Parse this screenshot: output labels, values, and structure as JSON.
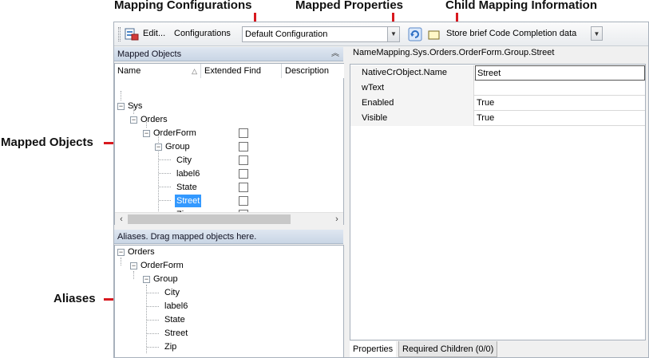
{
  "callouts": {
    "mapping_configurations": "Mapping Configurations",
    "mapped_properties": "Mapped Properties",
    "child_mapping_information": "Child Mapping Information",
    "mapped_objects": "Mapped Objects",
    "aliases": "Aliases"
  },
  "toolbar": {
    "edit_label": "Edit...",
    "configurations_label": "Configurations",
    "configuration_value": "Default Configuration",
    "store_label": "Store brief Code Completion data"
  },
  "mapped_objects": {
    "header": "Mapped Objects",
    "columns": [
      "Name",
      "Extended Find",
      "Description"
    ],
    "tree": [
      {
        "label": "Sys"
      },
      {
        "label": "Orders"
      },
      {
        "label": "OrderForm"
      },
      {
        "label": "Group"
      },
      {
        "label": "City"
      },
      {
        "label": "label6"
      },
      {
        "label": "State"
      },
      {
        "label": "Street"
      },
      {
        "label": "Zip"
      }
    ]
  },
  "aliases": {
    "header": "Aliases. Drag mapped objects here.",
    "tree": [
      {
        "label": "Orders"
      },
      {
        "label": "OrderForm"
      },
      {
        "label": "Group"
      },
      {
        "label": "City"
      },
      {
        "label": "label6"
      },
      {
        "label": "State"
      },
      {
        "label": "Street"
      },
      {
        "label": "Zip"
      }
    ]
  },
  "properties": {
    "path": "NameMapping.Sys.Orders.OrderForm.Group.Street",
    "rows": [
      {
        "name": "NativeCrObject.Name",
        "value": "Street"
      },
      {
        "name": "wText",
        "value": ""
      },
      {
        "name": "Enabled",
        "value": "True"
      },
      {
        "name": "Visible",
        "value": "True"
      }
    ],
    "tabs": [
      "Properties",
      "Required Children (0/0)"
    ]
  }
}
